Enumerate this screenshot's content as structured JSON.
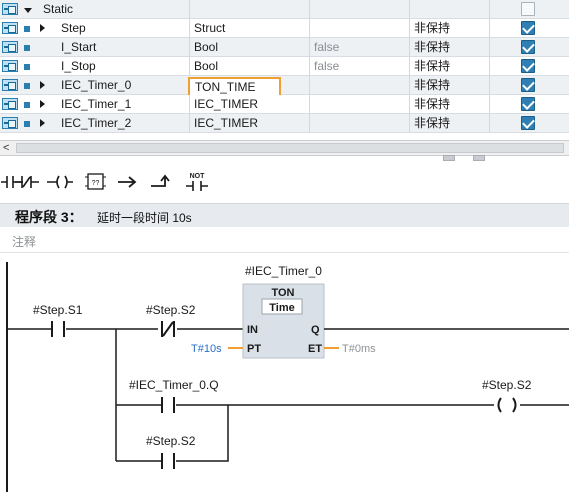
{
  "var_table": {
    "rows": [
      {
        "name": "Static",
        "type": "",
        "default": "",
        "retain": "",
        "checked": false,
        "expand": "open",
        "section": true
      },
      {
        "name": "Step",
        "type": "Struct",
        "default": "",
        "retain": "非保持",
        "checked": true,
        "expand": "closed"
      },
      {
        "name": "I_Start",
        "type": "Bool",
        "default": "false",
        "retain": "非保持",
        "checked": true,
        "expand": "none"
      },
      {
        "name": "I_Stop",
        "type": "Bool",
        "default": "false",
        "retain": "非保持",
        "checked": true,
        "expand": "none"
      },
      {
        "name": "IEC_Timer_0",
        "type": "TON_TIME",
        "default": "",
        "retain": "非保持",
        "checked": true,
        "expand": "closed",
        "editing": true
      },
      {
        "name": "IEC_Timer_1",
        "type": "IEC_TIMER",
        "default": "",
        "retain": "非保持",
        "checked": true,
        "expand": "closed"
      },
      {
        "name": "IEC_Timer_2",
        "type": "IEC_TIMER",
        "default": "",
        "retain": "非保持",
        "checked": true,
        "expand": "closed"
      }
    ]
  },
  "toolbar": {
    "buttons": [
      {
        "id": "no-contact",
        "icon": "normally-open-contact-icon"
      },
      {
        "id": "nc-contact",
        "icon": "normally-closed-contact-icon"
      },
      {
        "id": "coil",
        "icon": "coil-icon"
      },
      {
        "id": "empty-box",
        "icon": "empty-box-icon",
        "label": "??"
      },
      {
        "id": "open-branch",
        "icon": "open-branch-icon"
      },
      {
        "id": "close-branch",
        "icon": "close-branch-icon"
      },
      {
        "id": "not-contact",
        "icon": "invert-rlo-icon",
        "label": "NOT"
      }
    ]
  },
  "network": {
    "title": "程序段 3：",
    "subtitle": "延时一段时间 10s",
    "comment_placeholder": "注释"
  },
  "ladder": {
    "timer_instance": "#IEC_Timer_0",
    "timer_type": "TON",
    "timer_subtype": "Time",
    "pin_in": "IN",
    "pin_q": "Q",
    "pin_pt": "PT",
    "pin_et": "ET",
    "pt_value": "T#10s",
    "et_value": "T#0ms",
    "contact1": "#Step.S1",
    "contact2": "#Step.S2",
    "contact3": "#IEC_Timer_0.Q",
    "contact4": "#Step.S2",
    "coil": "#Step.S2"
  },
  "colors": {
    "wire": "#1a1a1a",
    "box_fill": "#d9e0e7",
    "box_header": "#cfd7df",
    "param_line": "#f0a030",
    "param_text": "#2a6fc0",
    "edit_border": "#f0a030"
  }
}
